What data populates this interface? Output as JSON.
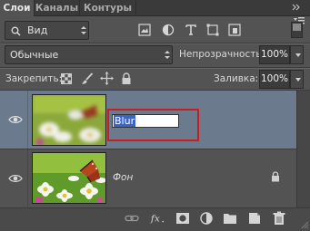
{
  "tabs": [
    {
      "label": "Слои",
      "active": true
    },
    {
      "label": "Каналы",
      "active": false
    },
    {
      "label": "Контуры",
      "active": false
    }
  ],
  "filter": {
    "label": "Вид",
    "icon": "search-icon"
  },
  "blend": {
    "mode": "Обычные",
    "opacity_label": "Непрозрачность:",
    "opacity_value": "100%"
  },
  "lock": {
    "label": "Закрепить:",
    "fill_label": "Заливка:",
    "fill_value": "100%"
  },
  "layers": [
    {
      "name": "Blur",
      "selected": true,
      "editing": true
    },
    {
      "name": "Фон",
      "selected": false,
      "locked": true
    }
  ],
  "colors": {
    "panel": "#535353",
    "selection": "#6b7a8c",
    "highlight": "#c71f1f",
    "text_select": "#3a64c8"
  },
  "bottom_icons": [
    "link-icon",
    "fx-icon",
    "mask-icon",
    "adjustment-icon",
    "folder-icon",
    "new-layer-icon",
    "trash-icon"
  ]
}
